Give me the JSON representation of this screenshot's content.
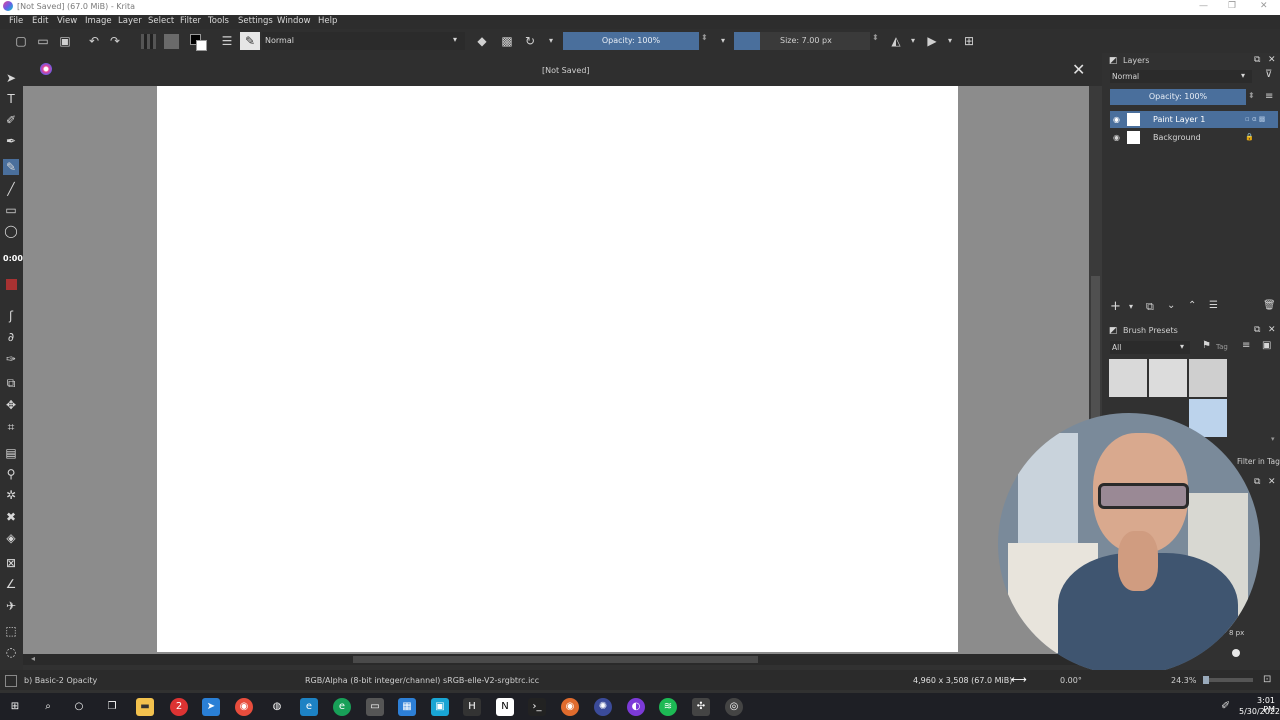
{
  "window": {
    "title": "[Not Saved]  (67.0 MiB)  - Krita"
  },
  "menu": [
    "File",
    "Edit",
    "View",
    "Image",
    "Layer",
    "Select",
    "Filter",
    "Tools",
    "Settings",
    "Window",
    "Help"
  ],
  "toolbar": {
    "blend_mode": "Normal",
    "opacity_label": "Opacity: 100%",
    "size_label": "Size: 7.00 px"
  },
  "canvas": {
    "tab_title": "[Not Saved]",
    "timer": "0:00"
  },
  "layers_docker": {
    "title": "Layers",
    "blend_mode": "Normal",
    "opacity_label": "Opacity:  100%",
    "layers": [
      {
        "name": "Paint Layer 1",
        "selected": true
      },
      {
        "name": "Background",
        "selected": false,
        "locked": true
      }
    ]
  },
  "brush_presets": {
    "title": "Brush Presets",
    "filter": "All",
    "tag_label": "Tag",
    "filter_in_tag": "Filter in Tag",
    "size_hint": "8 px"
  },
  "status": {
    "brush_name": "b) Basic-2 Opacity",
    "color_profile": "RGB/Alpha (8-bit integer/channel)  sRGB-elle-V2-srgbtrc.icc",
    "dimensions": "4,960 x 3,508 (67.0 MiB)",
    "rotation": "0.00°",
    "zoom": "24.3%"
  },
  "taskbar": {
    "time": "3:01 PM",
    "date": "5/30/2022"
  },
  "colors": {
    "accent": "#4a6f9c",
    "foreground_color": "#a83232"
  }
}
